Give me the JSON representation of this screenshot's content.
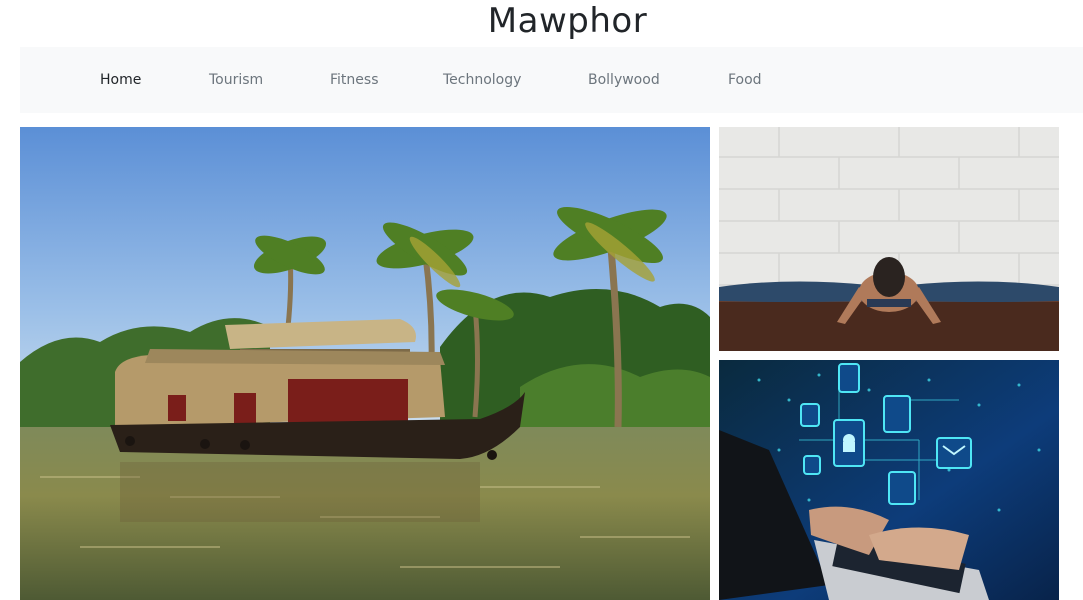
{
  "site": {
    "title": "Mawphor"
  },
  "nav": {
    "items": [
      {
        "label": "Home",
        "active": true
      },
      {
        "label": "Tourism",
        "active": false
      },
      {
        "label": "Fitness",
        "active": false
      },
      {
        "label": "Technology",
        "active": false
      },
      {
        "label": "Bollywood",
        "active": false
      },
      {
        "label": "Food",
        "active": false
      }
    ]
  },
  "colors": {
    "navbar_bg": "#f8f9fa",
    "active_link": "#212529",
    "link": "#6c757d"
  },
  "images": [
    {
      "subject": "houseboat-on-backwaters"
    },
    {
      "subject": "yoga-stretch"
    },
    {
      "subject": "laptop-cyber-security"
    }
  ]
}
